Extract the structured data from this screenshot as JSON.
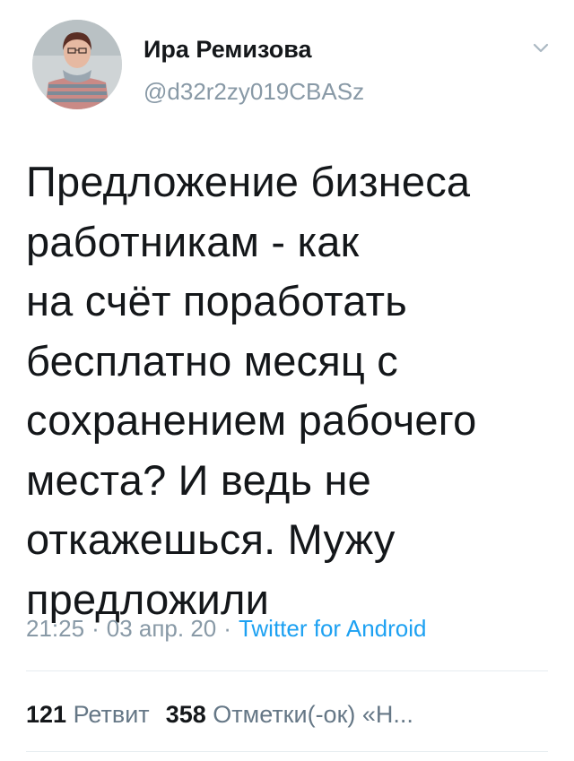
{
  "user": {
    "name": "Ира Ремизова",
    "handle": "@d32r2zy019CBASz"
  },
  "tweet": {
    "text_lines": [
      "Предложение бизнеса",
      "работникам - как",
      "на счёт поработать",
      "бесплатно месяц с",
      "сохранением рабочего",
      "места? И ведь не",
      "откажешься. Мужу",
      "предложили"
    ],
    "time": "21:25",
    "date": "03 апр. 20",
    "separator": "·",
    "source": "Twitter for Android"
  },
  "stats": {
    "retweets_count": "121",
    "retweets_label": "Ретвит",
    "likes_count": "358",
    "likes_label": "Отметки(-ок)",
    "more_label": "«Н..."
  },
  "icons": {
    "menu": "chevron-down-icon"
  },
  "colors": {
    "text": "#14171a",
    "secondary": "#8899a6",
    "link": "#1da1f2",
    "divider": "#e6ecf0"
  }
}
